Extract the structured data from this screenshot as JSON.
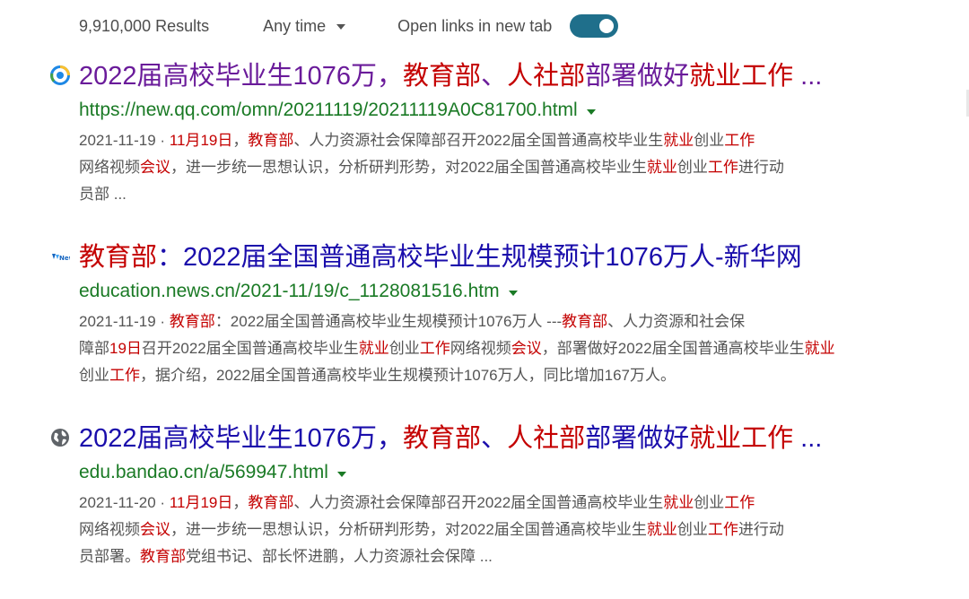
{
  "toolbar": {
    "results_count": "9,910,000 Results",
    "time_filter": "Any time",
    "new_tab_label": "Open links in new tab",
    "new_tab_enabled": true
  },
  "results": [
    {
      "favicon": "qq-news-icon",
      "visited": true,
      "title": [
        {
          "text": "2022届高校毕业生1076万，",
          "hl": false
        },
        {
          "text": "教育部",
          "hl": true
        },
        {
          "text": "、",
          "hl": false
        },
        {
          "text": "人社部",
          "hl": true
        },
        {
          "text": "部署做好",
          "hl": false
        },
        {
          "text": "就业工作",
          "hl": true
        },
        {
          "text": " ...",
          "hl": false
        }
      ],
      "url": "https://new.qq.com/omn/20211119/20211119A0C81700.html",
      "snippet": [
        [
          {
            "text": "2021-11-19 · ",
            "hl": false
          },
          {
            "text": "11月19日",
            "hl": true
          },
          {
            "text": "，",
            "hl": false
          },
          {
            "text": "教育部",
            "hl": true
          },
          {
            "text": "、人力资源社会保障部召开2022届全国普通高校毕业生",
            "hl": false
          },
          {
            "text": "就业",
            "hl": true
          },
          {
            "text": "创业",
            "hl": false
          },
          {
            "text": "工作",
            "hl": true
          }
        ],
        [
          {
            "text": "网络视频",
            "hl": false
          },
          {
            "text": "会议",
            "hl": true
          },
          {
            "text": "，进一步统一思想认识，分析研判形势，对2022届全国普通高校毕业生",
            "hl": false
          },
          {
            "text": "就业",
            "hl": true
          },
          {
            "text": "创业",
            "hl": false
          },
          {
            "text": "工作",
            "hl": true
          },
          {
            "text": "进行动",
            "hl": false
          }
        ],
        [
          {
            "text": "员部 ...",
            "hl": false
          }
        ]
      ]
    },
    {
      "favicon": "xinhua-news-icon",
      "visited": false,
      "title": [
        {
          "text": "教育部",
          "hl": true
        },
        {
          "text": "：2022届全国普通高校毕业生规模预计1076万人-新华网",
          "hl": false
        }
      ],
      "url": "education.news.cn/2021-11/19/c_1128081516.htm",
      "snippet": [
        [
          {
            "text": "2021-11-19 · ",
            "hl": false
          },
          {
            "text": "教育部",
            "hl": true
          },
          {
            "text": "：2022届全国普通高校毕业生规模预计1076万人 ---",
            "hl": false
          },
          {
            "text": "教育部",
            "hl": true
          },
          {
            "text": "、人力资源和社会保",
            "hl": false
          }
        ],
        [
          {
            "text": "障部",
            "hl": false
          },
          {
            "text": "19日",
            "hl": true
          },
          {
            "text": "召开2022届全国普通高校毕业生",
            "hl": false
          },
          {
            "text": "就业",
            "hl": true
          },
          {
            "text": "创业",
            "hl": false
          },
          {
            "text": "工作",
            "hl": true
          },
          {
            "text": "网络视频",
            "hl": false
          },
          {
            "text": "会议",
            "hl": true
          },
          {
            "text": "，部署做好2022届全国普通高校毕业生",
            "hl": false
          },
          {
            "text": "就业",
            "hl": true
          }
        ],
        [
          {
            "text": "创业",
            "hl": false
          },
          {
            "text": "工作",
            "hl": true
          },
          {
            "text": "，据介绍，2022届全国普通高校毕业生规模预计1076万人，同比增加167万人。",
            "hl": false
          }
        ]
      ]
    },
    {
      "favicon": "globe-icon",
      "visited": false,
      "title": [
        {
          "text": "2022届高校毕业生1076万，",
          "hl": false
        },
        {
          "text": "教育部",
          "hl": true
        },
        {
          "text": "、",
          "hl": false
        },
        {
          "text": "人社部",
          "hl": true
        },
        {
          "text": "部署做好",
          "hl": false
        },
        {
          "text": "就业工作",
          "hl": true
        },
        {
          "text": " ...",
          "hl": false
        }
      ],
      "url": "edu.bandao.cn/a/569947.html",
      "snippet": [
        [
          {
            "text": "2021-11-20 · ",
            "hl": false
          },
          {
            "text": "11月19日",
            "hl": true
          },
          {
            "text": "，",
            "hl": false
          },
          {
            "text": "教育部",
            "hl": true
          },
          {
            "text": "、人力资源社会保障部召开2022届全国普通高校毕业生",
            "hl": false
          },
          {
            "text": "就业",
            "hl": true
          },
          {
            "text": "创业",
            "hl": false
          },
          {
            "text": "工作",
            "hl": true
          }
        ],
        [
          {
            "text": "网络视频",
            "hl": false
          },
          {
            "text": "会议",
            "hl": true
          },
          {
            "text": "，进一步统一思想认识，分析研判形势，对2022届全国普通高校毕业生",
            "hl": false
          },
          {
            "text": "就业",
            "hl": true
          },
          {
            "text": "创业",
            "hl": false
          },
          {
            "text": "工作",
            "hl": true
          },
          {
            "text": "进行动",
            "hl": false
          }
        ],
        [
          {
            "text": "员部署。",
            "hl": false
          },
          {
            "text": "教育部",
            "hl": true
          },
          {
            "text": "党组书记、部长怀进鹏，人力资源社会保障 ...",
            "hl": false
          }
        ]
      ]
    }
  ],
  "colors": {
    "title_link": "#1a0dab",
    "title_visited": "#6a1b9a",
    "highlight": "#c40000",
    "url": "#1a7a25",
    "snippet": "#555555",
    "toggle_on": "#1f6f8b"
  }
}
